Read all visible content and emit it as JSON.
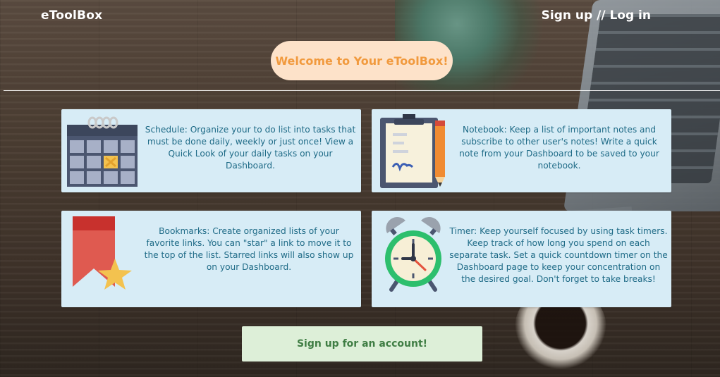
{
  "header": {
    "brand": "eToolBox",
    "auth_link": "Sign up // Log in"
  },
  "hero": {
    "title": "Welcome to Your eToolBox!"
  },
  "features": {
    "schedule": {
      "icon": "calendar-icon",
      "description": "Schedule: Organize your to do list into tasks that must be done daily, weekly or just once! View a Quick Look of your daily tasks on your Dashboard."
    },
    "notebook": {
      "icon": "clipboard-pencil-icon",
      "description": "Notebook: Keep a list of important notes and subscribe to other user's notes! Write a quick note from your Dashboard to be saved to your notebook."
    },
    "bookmarks": {
      "icon": "bookmark-star-icon",
      "description": "Bookmarks: Create organized lists of your favorite links. You can \"star\" a link to move it to the top of the list. Starred links will also show up on your Dashboard."
    },
    "timer": {
      "icon": "alarm-clock-icon",
      "description": "Timer: Keep yourself focused by using task timers. Keep track of how long you spend on each separate task. Set a quick countdown timer on the Dashboard page to keep your concentration on the desired goal. Don't forget to take breaks!"
    }
  },
  "cta": {
    "signup_label": "Sign up for an account!"
  },
  "colors": {
    "card_background": "#d7ecf6",
    "card_text": "#1f6b87",
    "hero_background": "#fde2c9",
    "hero_text": "#f19a3e",
    "cta_background": "#ddefd8",
    "cta_text": "#3f7d44"
  }
}
